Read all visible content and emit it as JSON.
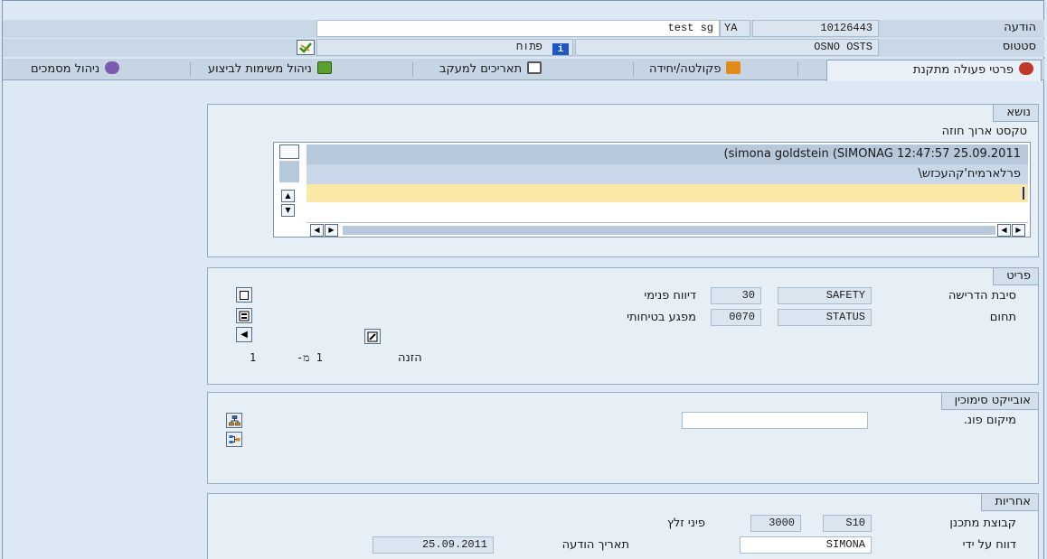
{
  "header": {
    "notification_label": "הודעה",
    "notification_number": "10126443",
    "notification_type": "YA",
    "notification_desc": "test sg",
    "status_label": "סטטוס",
    "status_value": "OSNO OSTS",
    "status_open_text": "פתוח"
  },
  "tabs": [
    {
      "label": "פרטי פעולה מתקנת",
      "icon": "action-icon"
    },
    {
      "label": "פקולטה/יחידה",
      "icon": "house-icon"
    },
    {
      "label": "תאריכים למעקב",
      "icon": "calendar-icon"
    },
    {
      "label": "ניהול משימות לביצוע",
      "icon": "tasks-icon"
    },
    {
      "label": "ניהול מסמכים",
      "icon": "documents-icon"
    }
  ],
  "subject": {
    "title": "נושא",
    "long_text_label": "טקסט ארוך חוזה",
    "lines": [
      "(simona goldstein (SIMONAG 12:47:57 25.09.2011",
      "פרלארמיח'קהעכזש\\"
    ]
  },
  "item": {
    "title": "פריט",
    "reason_label": "סיבת הדרישה",
    "reason_code": "SAFETY",
    "reason_num": "30",
    "reason_text": "דיווח פנימי",
    "area_label": "תחום",
    "area_code": "STATUS",
    "area_num": "0070",
    "area_text": "מפגע בטיחותי",
    "entry_label": "הזנה",
    "entry_of": "1 מ-",
    "entry_total": "1"
  },
  "reference_object": {
    "title": "אובייקט סימוכין",
    "location_label": "מיקום פונ.",
    "location_value": ""
  },
  "responsibility": {
    "title": "אחריות",
    "planner_group_label": "קבוצת מתכנן",
    "planner_group_code": "S10",
    "planner_group_num": "3000",
    "planner_group_name": "פיני זלץ",
    "reported_by_label": "דווח על ידי",
    "reported_by_value": "SIMONA",
    "notification_date_label": "תאריך הודעה",
    "notification_date_value": "25.09.2011"
  },
  "colors": {
    "background": "#dce8f3",
    "highlight_line": "#fbe8a6",
    "selected_line": "#c8d8e8"
  }
}
